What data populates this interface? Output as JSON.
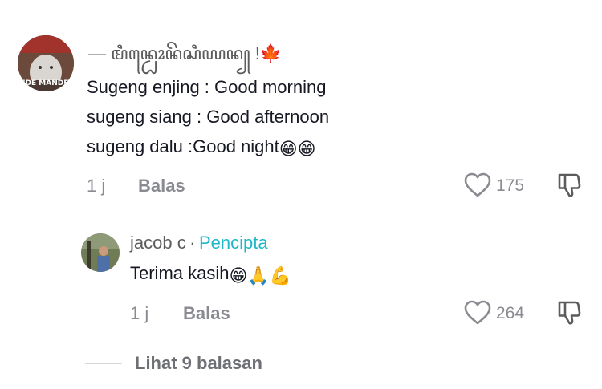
{
  "comments": [
    {
      "author": "— ꦩꦶꦤ꧀ꦝꦺꦴꦤꦼꦱꦶꦪꦤ꧀ !🍁",
      "avatar_caption": "NDE MANDE",
      "lines": [
        "Sugeng enjing : Good morning",
        "sugeng siang : Good afternoon",
        "sugeng dalu :Good night"
      ],
      "trailing_emoji": "😁😁",
      "time": "1 j",
      "reply_label": "Balas",
      "like_count": "175"
    }
  ],
  "reply": {
    "author": "jacob c",
    "separator": "·",
    "badge": "Pencipta",
    "text": "Terima kasih",
    "trailing_emoji": "😁🙏💪",
    "time": "1 j",
    "reply_label": "Balas",
    "like_count": "264"
  },
  "view_replies": {
    "label": "Lihat 9 balasan"
  },
  "colors": {
    "accent": "#20b8c8",
    "meta": "#8a8b91",
    "text": "#161823"
  },
  "icons": [
    "heart-icon",
    "dislike-icon"
  ]
}
